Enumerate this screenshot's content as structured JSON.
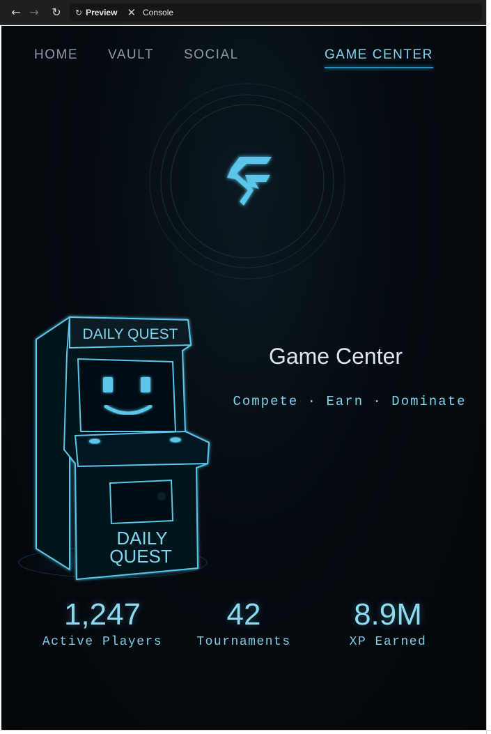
{
  "browser": {
    "back_icon": "←",
    "forward_icon": "→",
    "reload_icon": "↻",
    "preview_icon": "↻",
    "preview_label": "Preview",
    "console_icon": "✕",
    "console_label": "Console"
  },
  "nav": {
    "items": [
      {
        "label": "HOME",
        "active": false
      },
      {
        "label": "VAULT",
        "active": false
      },
      {
        "label": "SOCIAL",
        "active": false
      },
      {
        "label": "GAME CENTER",
        "active": true
      }
    ]
  },
  "arcade": {
    "marquee": "DAILY QUEST",
    "panel_line1": "DAILY",
    "panel_line2": "QUEST"
  },
  "hero": {
    "title": "Game Center",
    "subtitle": "Compete · Earn · Dominate"
  },
  "stats": [
    {
      "value": "1,247",
      "label": "Active Players"
    },
    {
      "value": "42",
      "label": "Tournaments"
    },
    {
      "value": "8.9M",
      "label": "XP Earned"
    }
  ],
  "colors": {
    "accent": "#7fd4ef",
    "background": "#03070a",
    "nav_inactive": "#8d99a3"
  }
}
